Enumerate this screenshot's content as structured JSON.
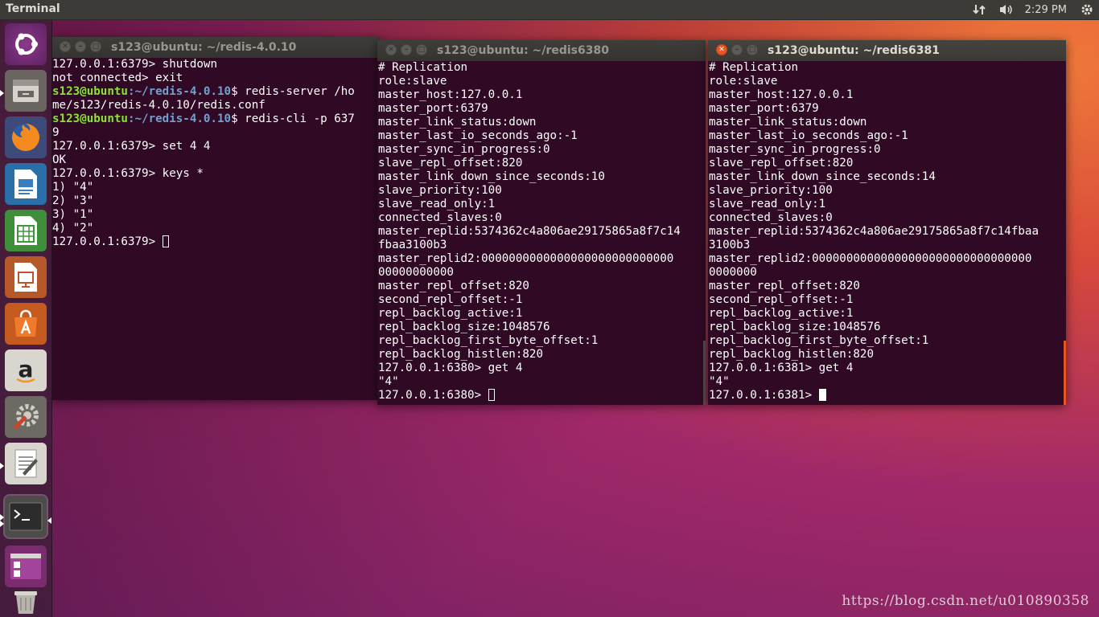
{
  "top_panel": {
    "app_title": "Terminal",
    "time": "2:29 PM"
  },
  "launcher": {
    "items": [
      {
        "name": "ubuntu-dash-icon"
      },
      {
        "name": "files-icon"
      },
      {
        "name": "firefox-icon"
      },
      {
        "name": "writer-icon"
      },
      {
        "name": "calc-icon"
      },
      {
        "name": "impress-icon"
      },
      {
        "name": "software-center-icon"
      },
      {
        "name": "amazon-icon"
      },
      {
        "name": "system-settings-icon"
      },
      {
        "name": "text-editor-icon"
      },
      {
        "name": "terminal-icon"
      },
      {
        "name": "workspace-switcher-icon"
      },
      {
        "name": "trash-icon"
      }
    ]
  },
  "windows": {
    "w1": {
      "title": "s123@ubuntu: ~/redis-4.0.10",
      "lines": [
        {
          "t": "127.0.0.1:6379> shutdown"
        },
        {
          "t": "not connected> exit"
        },
        {
          "u": "s123@ubuntu",
          "p": ":~/redis-4.0.10",
          "t": "$ redis-server /ho"
        },
        {
          "t": "me/s123/redis-4.0.10/redis.conf"
        },
        {
          "u": "s123@ubuntu",
          "p": ":~/redis-4.0.10",
          "t": "$ redis-cli -p 637"
        },
        {
          "t": "9"
        },
        {
          "t": "127.0.0.1:6379> set 4 4"
        },
        {
          "t": "OK"
        },
        {
          "t": "127.0.0.1:6379> keys *"
        },
        {
          "t": "1) \"4\""
        },
        {
          "t": "2) \"3\""
        },
        {
          "t": "3) \"1\""
        },
        {
          "t": "4) \"2\""
        },
        {
          "t": "127.0.0.1:6379> ",
          "cursor": "hollow"
        }
      ]
    },
    "w2": {
      "title": "s123@ubuntu: ~/redis6380",
      "lines": [
        {
          "t": "# Replication"
        },
        {
          "t": "role:slave"
        },
        {
          "t": "master_host:127.0.0.1"
        },
        {
          "t": "master_port:6379"
        },
        {
          "t": "master_link_status:down"
        },
        {
          "t": "master_last_io_seconds_ago:-1"
        },
        {
          "t": "master_sync_in_progress:0"
        },
        {
          "t": "slave_repl_offset:820"
        },
        {
          "t": "master_link_down_since_seconds:10"
        },
        {
          "t": "slave_priority:100"
        },
        {
          "t": "slave_read_only:1"
        },
        {
          "t": "connected_slaves:0"
        },
        {
          "t": "master_replid:5374362c4a806ae29175865a8f7c14"
        },
        {
          "t": "fbaa3100b3"
        },
        {
          "t": "master_replid2:0000000000000000000000000000"
        },
        {
          "t": "00000000000"
        },
        {
          "t": "master_repl_offset:820"
        },
        {
          "t": "second_repl_offset:-1"
        },
        {
          "t": "repl_backlog_active:1"
        },
        {
          "t": "repl_backlog_size:1048576"
        },
        {
          "t": "repl_backlog_first_byte_offset:1"
        },
        {
          "t": "repl_backlog_histlen:820"
        },
        {
          "t": "127.0.0.1:6380> get 4"
        },
        {
          "t": "\"4\""
        },
        {
          "t": "127.0.0.1:6380> ",
          "cursor": "hollow"
        }
      ]
    },
    "w3": {
      "title": "s123@ubuntu: ~/redis6381",
      "lines": [
        {
          "t": "# Replication"
        },
        {
          "t": "role:slave"
        },
        {
          "t": "master_host:127.0.0.1"
        },
        {
          "t": "master_port:6379"
        },
        {
          "t": "master_link_status:down"
        },
        {
          "t": "master_last_io_seconds_ago:-1"
        },
        {
          "t": "master_sync_in_progress:0"
        },
        {
          "t": "slave_repl_offset:820"
        },
        {
          "t": "master_link_down_since_seconds:14"
        },
        {
          "t": "slave_priority:100"
        },
        {
          "t": "slave_read_only:1"
        },
        {
          "t": "connected_slaves:0"
        },
        {
          "t": "master_replid:5374362c4a806ae29175865a8f7c14fbaa"
        },
        {
          "t": "3100b3"
        },
        {
          "t": "master_replid2:00000000000000000000000000000000"
        },
        {
          "t": "0000000"
        },
        {
          "t": "master_repl_offset:820"
        },
        {
          "t": "second_repl_offset:-1"
        },
        {
          "t": "repl_backlog_active:1"
        },
        {
          "t": "repl_backlog_size:1048576"
        },
        {
          "t": "repl_backlog_first_byte_offset:1"
        },
        {
          "t": "repl_backlog_histlen:820"
        },
        {
          "t": "127.0.0.1:6381> get 4"
        },
        {
          "t": "\"4\""
        },
        {
          "t": "127.0.0.1:6381> ",
          "cursor": "solid"
        }
      ]
    }
  },
  "watermark": "https://blog.csdn.net/u010890358",
  "colors": {
    "terminal_bg": "#300a24",
    "prompt_user": "#8ae234",
    "prompt_path": "#729fcf",
    "accent": "#e95420"
  }
}
